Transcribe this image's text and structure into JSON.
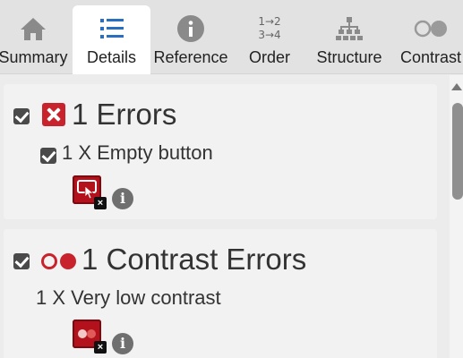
{
  "tabs": [
    {
      "label": "Summary",
      "icon": "home-icon",
      "active": false
    },
    {
      "label": "Details",
      "icon": "list-icon",
      "active": true
    },
    {
      "label": "Reference",
      "icon": "info-icon",
      "active": false
    },
    {
      "label": "Order",
      "icon": "order-icon",
      "active": false,
      "icon_text_top": "1→2",
      "icon_text_bottom": "3→4"
    },
    {
      "label": "Structure",
      "icon": "hierarchy-icon",
      "active": false
    },
    {
      "label": "Contrast",
      "icon": "contrast-icon",
      "active": false
    }
  ],
  "errors_panel": {
    "heading": "1 Errors",
    "item": "1 X Empty button",
    "badge_icon": "empty-button-icon"
  },
  "contrast_panel": {
    "heading": "1 Contrast Errors",
    "item": "1 X Very low contrast",
    "badge_icon": "very-low-contrast-icon"
  },
  "info_glyph": "i",
  "colors": {
    "error_red": "#c8232c",
    "accent_blue": "#2a6fbf",
    "tab_icon_gray": "#8a8a8a"
  }
}
